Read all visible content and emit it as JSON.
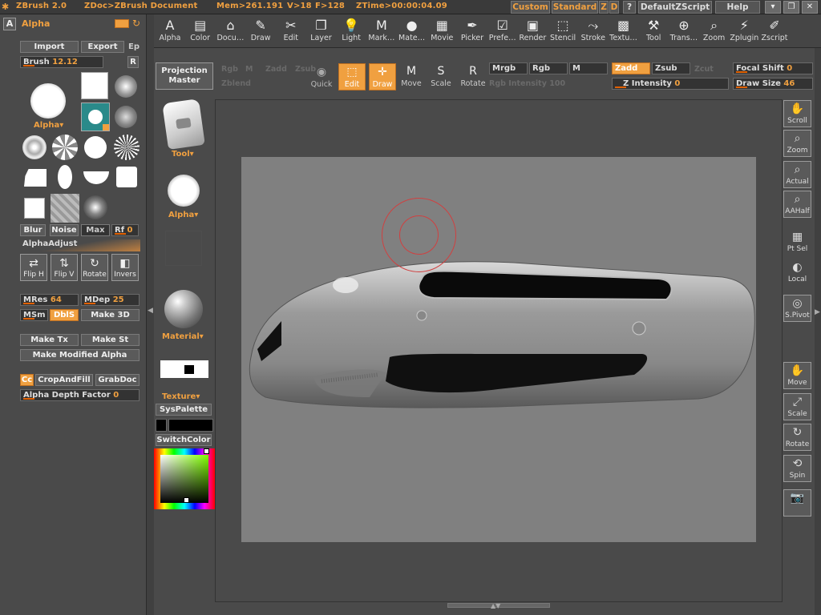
{
  "app": {
    "name": "ZBrush 2.0",
    "doc": "ZDoc>ZBrush Document",
    "mem": "Mem>261.191",
    "v": "V>18",
    "f": "F>128",
    "ztime": "ZTime>00:00:04.09"
  },
  "titlebar": {
    "custom": "Custom",
    "standard": "Standard",
    "z": "Z",
    "d": "D",
    "help_q": "?",
    "script": "DefaultZScript",
    "help": "Help"
  },
  "menus": [
    {
      "label": "Alpha",
      "icon": "A"
    },
    {
      "label": "Color",
      "icon": "▤"
    },
    {
      "label": "Docu…",
      "icon": "⌂"
    },
    {
      "label": "Draw",
      "icon": "✎"
    },
    {
      "label": "Edit",
      "icon": "✂"
    },
    {
      "label": "Layer",
      "icon": "❐"
    },
    {
      "label": "Light",
      "icon": "💡"
    },
    {
      "label": "Mark…",
      "icon": "M"
    },
    {
      "label": "Mate…",
      "icon": "●"
    },
    {
      "label": "Movie",
      "icon": "▦"
    },
    {
      "label": "Picker",
      "icon": "✒"
    },
    {
      "label": "Prefe…",
      "icon": "☑"
    },
    {
      "label": "Render",
      "icon": "▣"
    },
    {
      "label": "Stencil",
      "icon": "⬚"
    },
    {
      "label": "Stroke",
      "icon": "⤳"
    },
    {
      "label": "Textu…",
      "icon": "▩"
    },
    {
      "label": "Tool",
      "icon": "⚒"
    },
    {
      "label": "Trans…",
      "icon": "⊕"
    },
    {
      "label": "Zoom",
      "icon": "⌕"
    },
    {
      "label": "Zplugin",
      "icon": "⚡"
    },
    {
      "label": "Zscript",
      "icon": "✐"
    }
  ],
  "alpha_panel": {
    "title": "Alpha",
    "import": "Import",
    "export": "Export",
    "ep": "Ep",
    "brush_label": "Brush",
    "brush_value": "12.12",
    "r": "R",
    "alpha_selector": "Alpha",
    "blur": "Blur",
    "noise": "Noise",
    "max": "Max",
    "rf_label": "Rf",
    "rf_value": "0",
    "alpha_adjust": "AlphaAdjust",
    "flip_h": "Flip H",
    "flip_v": "Flip V",
    "rotate": "Rotate",
    "invers": "Invers",
    "mres_label": "MRes",
    "mres_value": "64",
    "mdep_label": "MDep",
    "mdep_value": "25",
    "msm": "MSm",
    "dbls": "DblS",
    "make_3d": "Make 3D",
    "make_tx": "Make Tx",
    "make_st": "Make St",
    "make_modified_alpha": "Make Modified Alpha",
    "cc": "Cc",
    "crop_and_fill": "CropAndFill",
    "grab_doc": "GrabDoc",
    "alpha_depth_label": "Alpha Depth Factor",
    "alpha_depth_value": "0"
  },
  "tool_column": {
    "projection_master": "Projection\nMaster",
    "tool": "Tool",
    "alpha": "Alpha",
    "material": "Material",
    "texture": "Texture",
    "syspalette": "SysPalette",
    "switchcolor": "SwitchColor"
  },
  "top_bar": {
    "rgb_label_dim": "Rgb",
    "m_dim": "M",
    "zadd_dim": "Zadd",
    "zsub_dim": "Zsub",
    "rgb_intensity_dim": "Rgb Intensity 100",
    "zblend_dim": "Zblend",
    "quick": "Quick",
    "edit": "Edit",
    "draw": "Draw",
    "move": "Move",
    "scale": "Scale",
    "rotate": "Rotate",
    "mrgb": "Mrgb",
    "rgb": "Rgb",
    "m": "M",
    "zadd": "Zadd",
    "zsub": "Zsub",
    "zcut": "Zcut",
    "z_intensity_label": "Z Intensity",
    "z_intensity_value": "0",
    "focal_shift_label": "Focal Shift",
    "focal_shift_value": "0",
    "draw_size_label": "Draw Size",
    "draw_size_value": "46"
  },
  "right_column": [
    {
      "name": "scroll",
      "label": "Scroll",
      "icon": "✋"
    },
    {
      "name": "zoom",
      "label": "Zoom",
      "icon": "⌕"
    },
    {
      "name": "actual",
      "label": "Actual",
      "icon": "⌕"
    },
    {
      "name": "aahalf",
      "label": "AAHalf",
      "icon": "⌕"
    },
    {
      "name": "ptsel",
      "label": "Pt Sel",
      "icon": "▦"
    },
    {
      "name": "local",
      "label": "Local",
      "icon": "◐"
    },
    {
      "name": "spivot",
      "label": "S.Pivot",
      "icon": "◎"
    },
    {
      "name": "move",
      "label": "Move",
      "icon": "✋"
    },
    {
      "name": "scale",
      "label": "Scale",
      "icon": "⤢"
    },
    {
      "name": "rotate",
      "label": "Rotate",
      "icon": "↻"
    },
    {
      "name": "spin",
      "label": "Spin",
      "icon": "⟲"
    },
    {
      "name": "camera",
      "label": "",
      "icon": "📷"
    }
  ],
  "colors": {
    "accent": "#f0a040",
    "panel": "#4a4a4a",
    "canvas": "#808080",
    "brush_ring": "#d04040"
  }
}
